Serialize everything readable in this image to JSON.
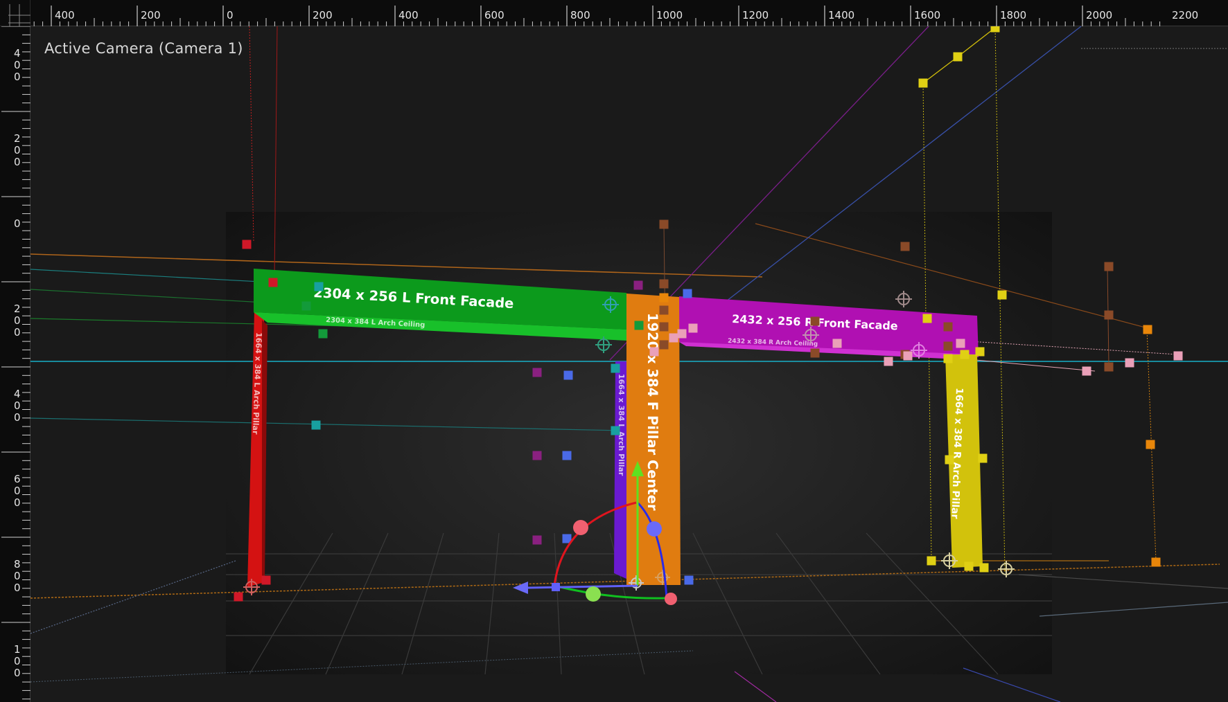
{
  "viewport": {
    "camera_label": "Active Camera (Camera 1)"
  },
  "ruler": {
    "top_ticks": [
      "400",
      "200",
      "0",
      "200",
      "400",
      "600",
      "800",
      "1000",
      "1200",
      "1400",
      "1600",
      "1800",
      "2000",
      "2200"
    ],
    "left_ticks": [
      [
        "4",
        "0",
        "0"
      ],
      [
        "2",
        "0",
        "0"
      ],
      [
        "0"
      ],
      [
        "2",
        "0",
        "0"
      ],
      [
        "4",
        "0",
        "0"
      ],
      [
        "6",
        "0",
        "0"
      ],
      [
        "8",
        "0",
        "0"
      ],
      [
        "1",
        "0",
        "0"
      ]
    ]
  },
  "layers": {
    "left_facade": "2304 x 256 L Front Facade",
    "left_ceiling": "2304 x 384 L Arch Ceiling",
    "right_facade": "2432 x 256 R Front Facade",
    "right_ceiling": "2432 x 384 R Arch Ceiling",
    "center_pillar": "1920 x 384 F Pillar Center",
    "left_pillar": "1664 x 384 L Arch Pillar",
    "purple_pillar": "1664 x 384 L Arch Pillar",
    "right_pillar": "1664 x 384 R Arch Pillar"
  },
  "colors": {
    "green": "#0fa020",
    "orange": "#e07a10",
    "magenta": "#b00fb0",
    "red": "#d01010",
    "purple": "#6a18d0",
    "yellow": "#d2c20c"
  }
}
